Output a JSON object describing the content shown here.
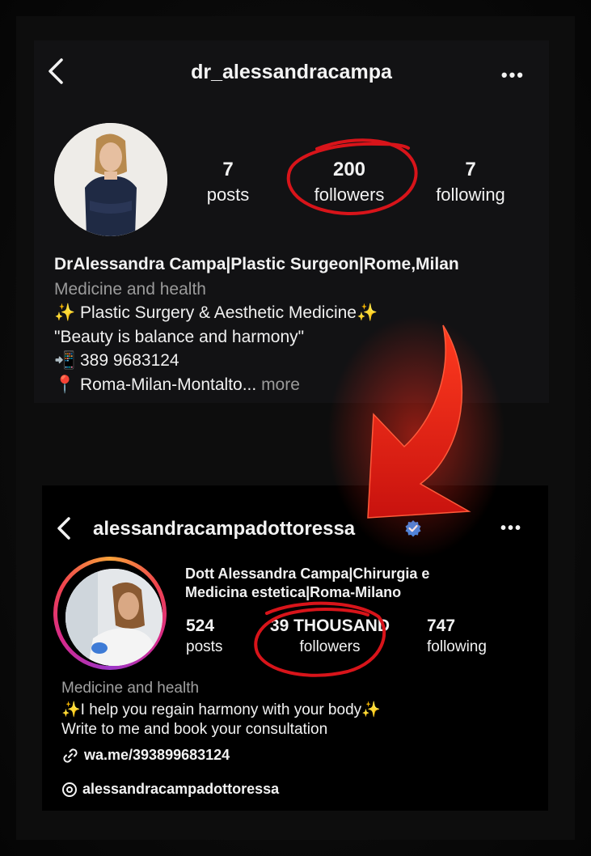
{
  "top_profile": {
    "username": "dr_alessandracampa",
    "stats": [
      {
        "value": "7",
        "label": "posts"
      },
      {
        "value": "200",
        "label": "followers"
      },
      {
        "value": "7",
        "label": "following"
      }
    ],
    "display_name": "DrAlessandra Campa|Plastic Surgeon|Rome,Milan",
    "category": "Medicine and health",
    "bio": [
      "✨ Plastic Surgery & Aesthetic Medicine✨",
      "\"Beauty is balance and harmony\"",
      "📲 389 9683124",
      "📍 Roma-Milan-Montalto..."
    ],
    "more_label": "more"
  },
  "bottom_profile": {
    "username": "alessandracampadottoressa",
    "display_name_line1": "Dott Alessandra Campa|Chirurgia e",
    "display_name_line2": "Medicina estetica|Roma-Milano",
    "stats": [
      {
        "value": "524",
        "label": "posts"
      },
      {
        "value": "39 THOUSAND",
        "label": "followers"
      },
      {
        "value": "747",
        "label": "following"
      }
    ],
    "category": "Medicine and health",
    "bio": [
      "✨I help you regain harmony with your body✨",
      "Write to me and book your consultation"
    ],
    "link": "wa.me/393899683124",
    "threads": "alessandracampadottoressa"
  },
  "colors": {
    "annotation_red": "#d8141a",
    "verified_blue": "#3a8ef0",
    "panel_bg": "#121214",
    "muted_text": "#9a9a9a"
  }
}
